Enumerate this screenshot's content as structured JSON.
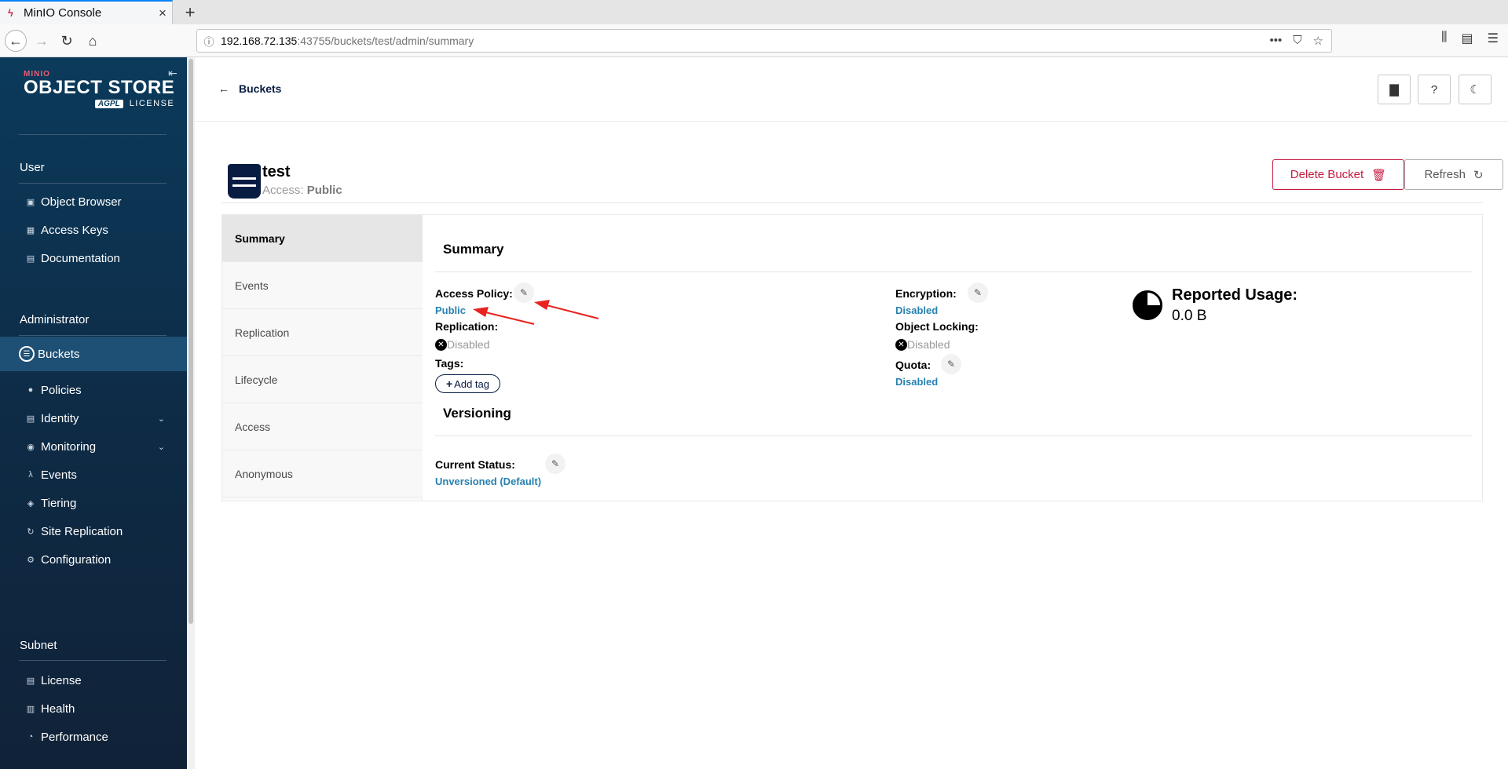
{
  "browser": {
    "tab_title": "MinIO Console",
    "tab_favicon": "minio-icon",
    "url_host": "192.168.72.135",
    "url_path": ":43755/buckets/test/admin/summary"
  },
  "sidebar": {
    "logo_brand": "MINIO",
    "logo_product": "OBJECT STORE",
    "logo_badge": "AGPL",
    "logo_license": "LICENSE",
    "sections": {
      "user": "User",
      "admin": "Administrator",
      "subnet": "Subnet"
    },
    "user_items": [
      {
        "label": "Object Browser",
        "icon": "object-browser-icon"
      },
      {
        "label": "Access Keys",
        "icon": "access-keys-icon"
      },
      {
        "label": "Documentation",
        "icon": "documentation-icon"
      }
    ],
    "admin_items": [
      {
        "label": "Buckets",
        "icon": "buckets-icon",
        "active": true
      },
      {
        "label": "Policies",
        "icon": "policies-icon"
      },
      {
        "label": "Identity",
        "icon": "identity-icon",
        "expandable": true
      },
      {
        "label": "Monitoring",
        "icon": "monitoring-icon",
        "expandable": true
      },
      {
        "label": "Events",
        "icon": "lambda-icon"
      },
      {
        "label": "Tiering",
        "icon": "tiering-icon"
      },
      {
        "label": "Site Replication",
        "icon": "site-replication-icon"
      },
      {
        "label": "Configuration",
        "icon": "configuration-icon"
      }
    ],
    "subnet_items": [
      {
        "label": "License",
        "icon": "license-icon"
      },
      {
        "label": "Health",
        "icon": "health-icon"
      },
      {
        "label": "Performance",
        "icon": "performance-icon"
      }
    ]
  },
  "header": {
    "back_label": "Buckets"
  },
  "bucket": {
    "name": "test",
    "access_prefix": "Access:",
    "access_value": "Public",
    "delete_label": "Delete Bucket",
    "refresh_label": "Refresh"
  },
  "tabs": [
    "Summary",
    "Events",
    "Replication",
    "Lifecycle",
    "Access",
    "Anonymous"
  ],
  "summary": {
    "title": "Summary",
    "access_policy_label": "Access Policy:",
    "access_policy_value": "Public",
    "replication_label": "Replication:",
    "replication_value": "Disabled",
    "tags_label": "Tags:",
    "add_tag_label": "Add tag",
    "encryption_label": "Encryption:",
    "encryption_value": "Disabled",
    "object_locking_label": "Object Locking:",
    "object_locking_value": "Disabled",
    "quota_label": "Quota:",
    "quota_value": "Disabled",
    "reported_usage_label": "Reported Usage:",
    "reported_usage_value": "0.0 B"
  },
  "versioning": {
    "title": "Versioning",
    "current_status_label": "Current Status:",
    "current_status_value": "Unversioned (Default)"
  },
  "colors": {
    "sidebar_bg": "#0b3a5b",
    "accent_link": "#2781b0",
    "danger": "#c51b3f",
    "annotation_arrow": "#e8231f"
  }
}
